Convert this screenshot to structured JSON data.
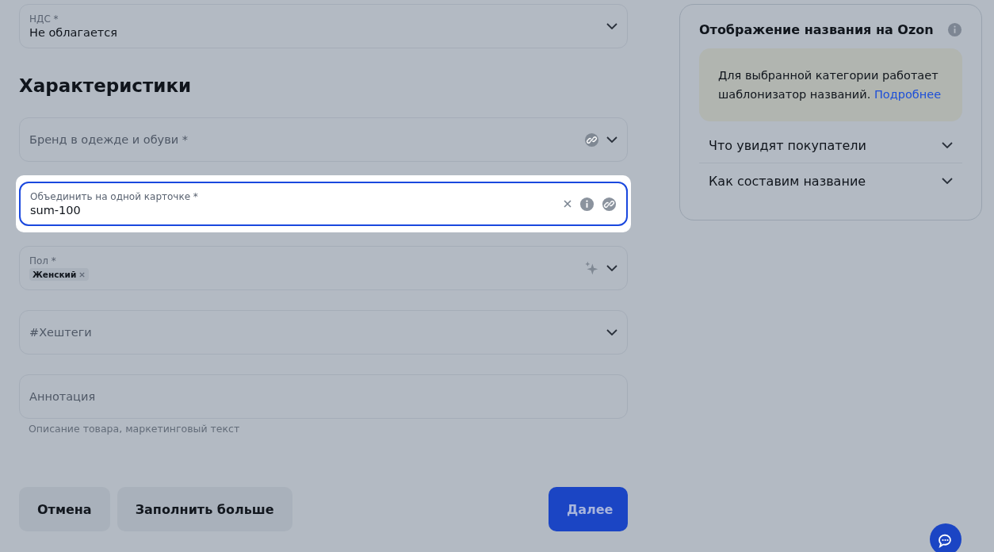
{
  "form": {
    "fields_top": [
      {
        "kind": "select",
        "label": "НДС *",
        "value": "Не облагается",
        "linked": false,
        "focused": false,
        "autofilled": false
      }
    ],
    "section_title": "Характеристики",
    "fields": [
      {
        "kind": "select",
        "placeholder": "Бренд в одежде и обуви *",
        "linked": true,
        "focused": false,
        "autofilled": false
      },
      {
        "kind": "input",
        "label": "Объединить на одной карточке *",
        "value": "sum-100",
        "linked": true,
        "focused": true,
        "autofilled": false
      },
      {
        "kind": "tags",
        "label": "Пол *",
        "tags": [
          "Женский"
        ],
        "linked": false,
        "focused": false,
        "autofilled": true
      },
      {
        "kind": "select",
        "placeholder": "#Хештеги",
        "linked": false,
        "focused": false,
        "autofilled": false
      },
      {
        "kind": "textarea",
        "placeholder": "Аннотация",
        "hint": "Описание товара, маркетинговый текст",
        "linked": false,
        "focused": false,
        "autofilled": false
      }
    ],
    "buttons": [
      {
        "label": "Отмена",
        "kind": "secondary"
      },
      {
        "label": "Заполнить больше",
        "kind": "secondary"
      },
      {
        "label": "Далее",
        "kind": "primary"
      }
    ]
  },
  "name_panel": {
    "title": "Отображение названия на Ozon",
    "notice": "Для выбранной категории работает шаблонизатор названий.",
    "notice_link": "Подробнее",
    "sections": [
      {
        "label": "Что увидят покупатели",
        "expanded": false
      },
      {
        "label": "Как составим название",
        "expanded": false
      }
    ]
  }
}
